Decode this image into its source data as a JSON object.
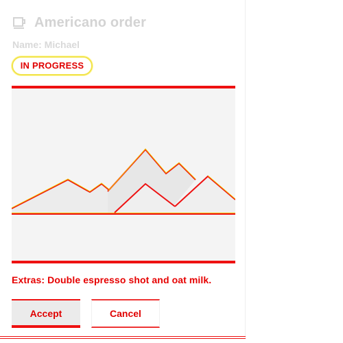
{
  "order": {
    "title": "Americano order",
    "customer": "Name: Michael",
    "status": "IN PROGRESS",
    "extras": "Extras: Double espresso shot and oat milk.",
    "image_icon": "mountain-landscape-placeholder"
  },
  "actions": {
    "accept_label": "Accept",
    "cancel_label": "Cancel"
  },
  "icons": {
    "title_icon": "coffee-cup-icon"
  },
  "colors": {
    "accent": "#ee1111",
    "badge_border": "#f1e34a",
    "muted_text": "#d3d3d3",
    "placeholder_bg": "#f4f4f4"
  }
}
